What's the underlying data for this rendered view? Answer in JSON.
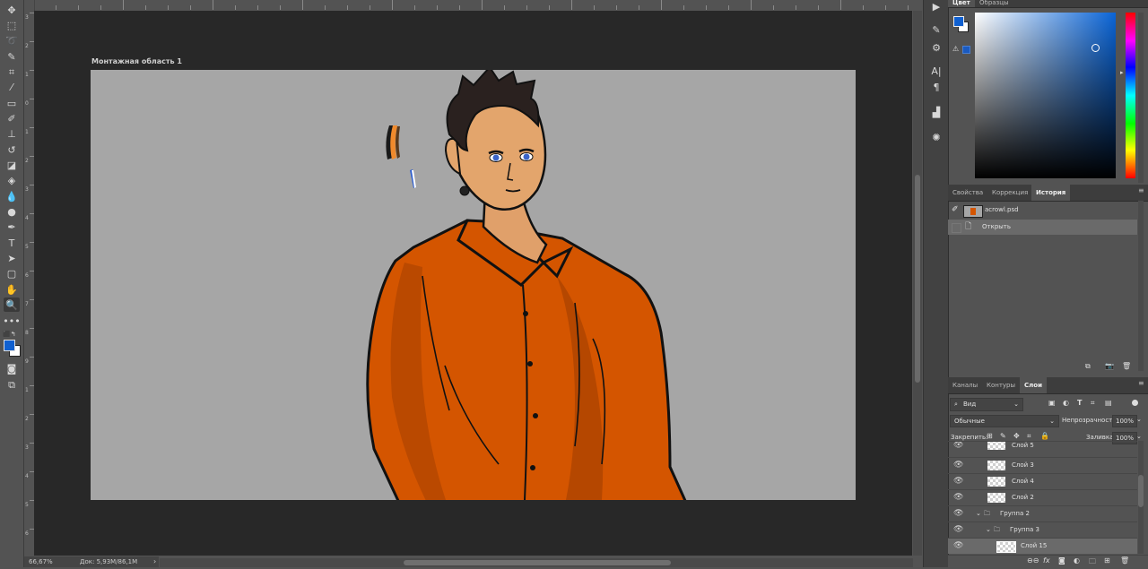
{
  "color_panel": {
    "tabs": [
      "Цвет",
      "Образцы"
    ],
    "fg_color": "#1060d0",
    "bg_color": "#ffffff"
  },
  "artboard": {
    "label": "Монтажная область 1"
  },
  "status": {
    "zoom": "66,67%",
    "doc": "Док: 5,93M/86,1M"
  },
  "props_tabs": [
    "Свойства",
    "Коррекция",
    "История"
  ],
  "history": {
    "snapshot": "acrowl.psd",
    "items": [
      "Открыть"
    ]
  },
  "layers_tabs": [
    "Каналы",
    "Контуры",
    "Слои"
  ],
  "layers": {
    "filter_kind": "Вид",
    "blend_mode": "Обычные",
    "opacity_label": "Непрозрачность:",
    "opacity_value": "100%",
    "lock_label": "Закрепить:",
    "fill_label": "Заливка:",
    "fill_value": "100%",
    "rows": [
      {
        "name": "Слой 5"
      },
      {
        "name": "Слой 3"
      },
      {
        "name": "Слой 4"
      },
      {
        "name": "Слой 2"
      },
      {
        "name": "Группа 2"
      },
      {
        "name": "Группа 3"
      },
      {
        "name": "Слой 15"
      }
    ]
  },
  "ruler_v_labels": [
    "3",
    "2",
    "1",
    "0",
    "1",
    "2",
    "3",
    "4",
    "5",
    "6",
    "7",
    "8",
    "9",
    "1",
    "2",
    "3",
    "4",
    "5",
    "6"
  ],
  "ruler_h_labels": [
    "",
    "0",
    "",
    "",
    "",
    "",
    "",
    "",
    "",
    "",
    "",
    "",
    ""
  ]
}
